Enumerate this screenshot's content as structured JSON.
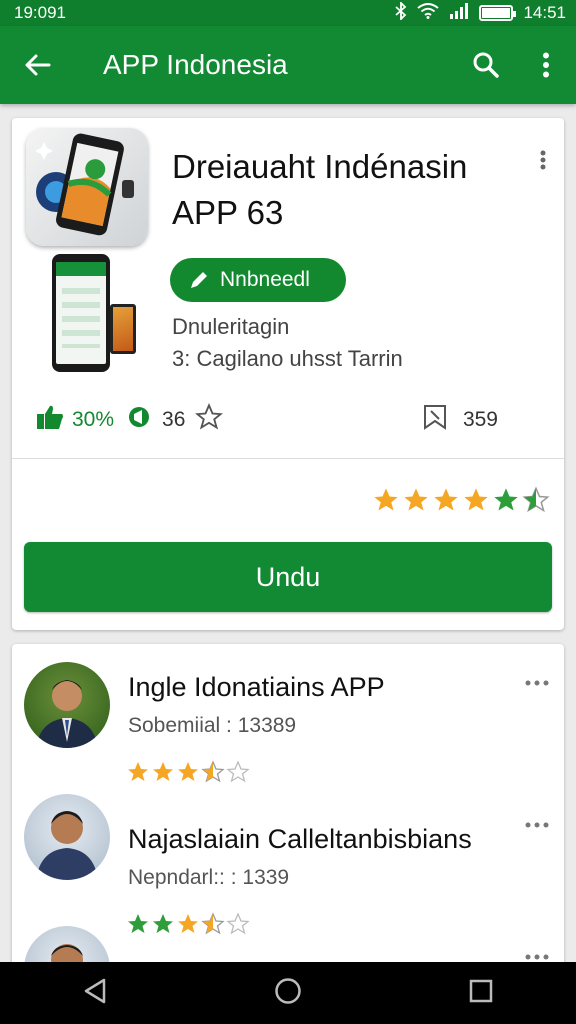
{
  "status_bar": {
    "time_left": "19:091",
    "time_right": "14:51"
  },
  "app_bar": {
    "title": "APP Indonesia",
    "back_icon": "arrow-left-icon",
    "search_icon": "search-icon",
    "menu_icon": "more-vertical-icon"
  },
  "app": {
    "title_line1": "Dreiauaht Indénasin",
    "title_line2": "APP 63",
    "installed_label": "Nnbneedl",
    "subtitle1": "Dnuleritagin",
    "subtitle2": "3: Cagilano uhsst Tarrin",
    "stats": {
      "likes": "30%",
      "shares": "36",
      "saves": "359"
    },
    "rating_stars": 5.5,
    "download_label": "Undu"
  },
  "reviews": [
    {
      "name": "Ingle Idonatiains APP",
      "meta": "Sobemiial : 13389",
      "stars": 3.5
    },
    {
      "name": "Najaslaiain Calleltanbisbians",
      "meta": "Nepndarl:: : 1339",
      "stars": 3.5
    }
  ],
  "colors": {
    "primary": "#118a33",
    "status_bar": "#0f7f2e",
    "star": "#f5a623",
    "star_green": "#2e9e3b"
  }
}
